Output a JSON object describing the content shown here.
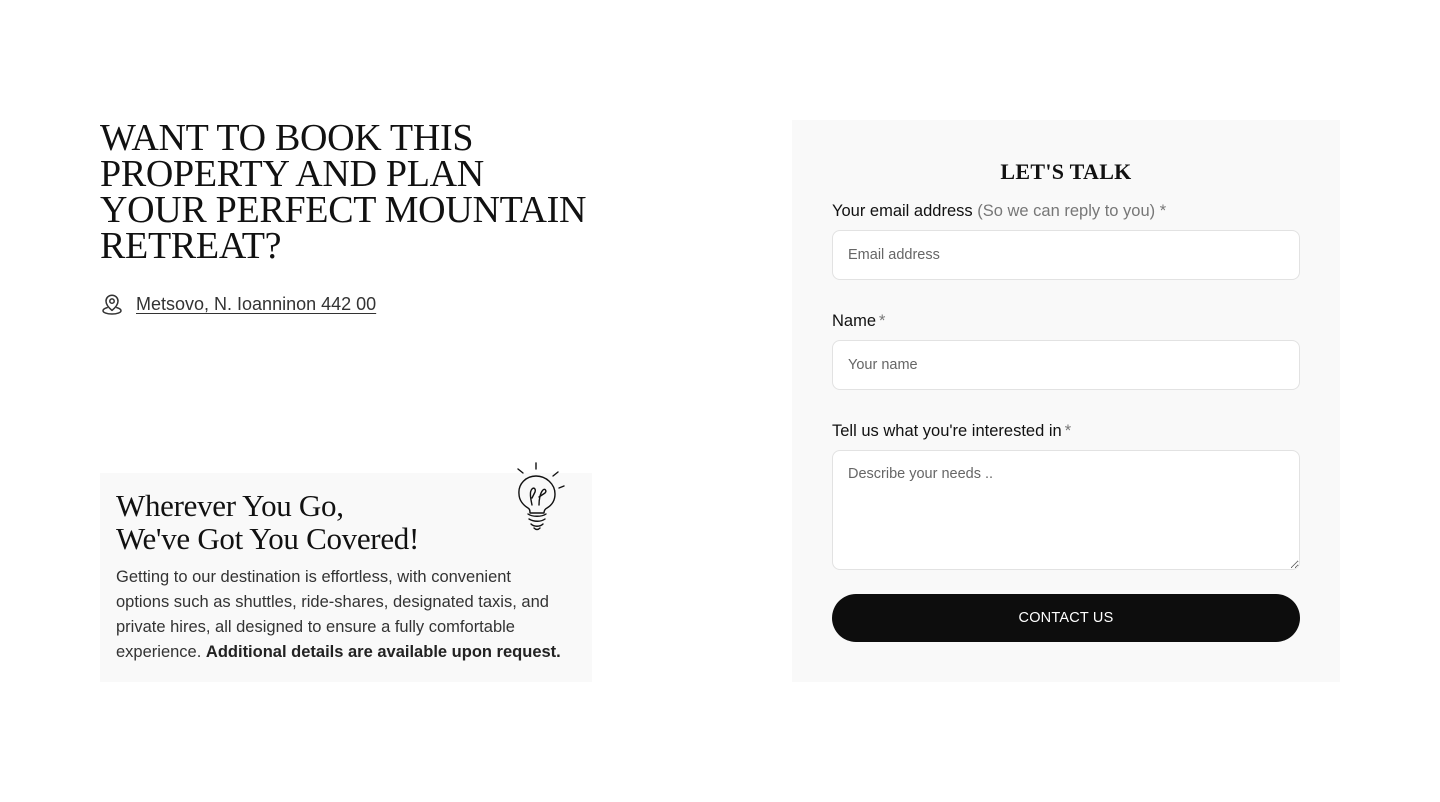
{
  "hero": {
    "headline": "WANT TO BOOK THIS PROPERTY AND PLAN YOUR PERFECT MOUNTAIN RETREAT?",
    "address": "Metsovo, N. Ioanninon 442 00",
    "address_icon": "map-pin-icon"
  },
  "info_card": {
    "title_line1": "Wherever You Go,",
    "title_line2": "We've Got You Covered!",
    "text": "Getting to our destination is effortless, with convenient options such as shuttles, ride-shares, designated taxis, and private hires, all designed to ensure a fully comfortable experience.",
    "text_bold": "Additional details are available upon request.",
    "illustration_icon": "lightbulb-icon"
  },
  "form": {
    "title": "LET'S TALK",
    "email": {
      "label": "Your email address",
      "hint": "(So we can reply to you)",
      "required_mark": "*",
      "placeholder": "Email address",
      "value": ""
    },
    "name": {
      "label": "Name",
      "required_mark": "*",
      "placeholder": "Your name",
      "value": ""
    },
    "interest": {
      "label": "Tell us what you're interested in",
      "required_mark": "*",
      "placeholder": "Describe your needs ..",
      "value": ""
    },
    "submit_label": "CONTACT US"
  },
  "colors": {
    "card_background": "#f9f9f9",
    "button_background": "#0d0d0d",
    "button_text": "#ffffff",
    "input_border": "#e2e2e2"
  }
}
